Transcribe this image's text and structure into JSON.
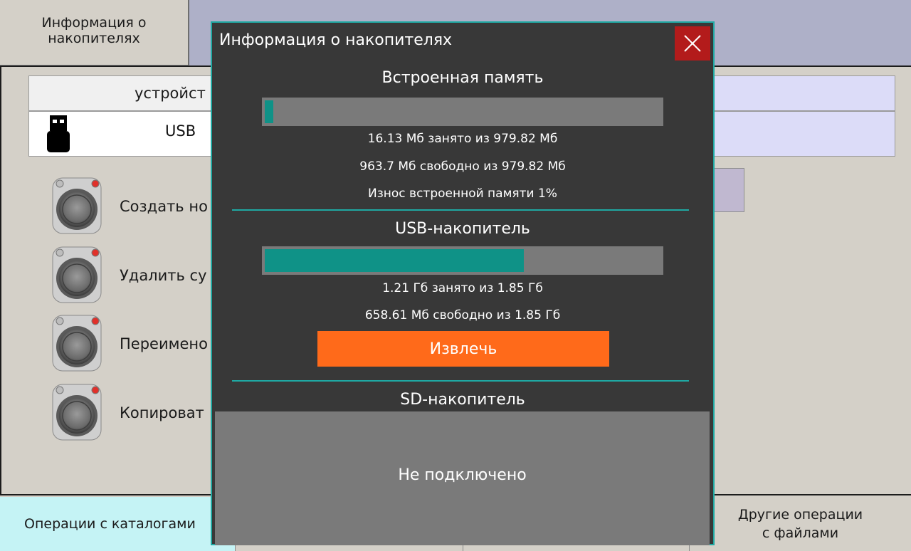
{
  "top_tabs": {
    "storage_info_line1": "Информация о",
    "storage_info_line2": "накопителях"
  },
  "device_table": {
    "header": "устройст",
    "device_name": "USB",
    "device_icon": "usb-drive-icon"
  },
  "operations": [
    {
      "label": "Создать но",
      "icon": "round-button-icon"
    },
    {
      "label": "Удалить су",
      "icon": "round-button-icon"
    },
    {
      "label": "Переимено",
      "icon": "round-button-icon"
    },
    {
      "label": "Копироват",
      "icon": "round-button-icon"
    }
  ],
  "bottom_tabs": {
    "directory_ops": "Операции с каталогами",
    "other_ops_line1": "Другие операции",
    "other_ops_line2": "с файлами"
  },
  "dialog": {
    "title": "Информация о накопителях",
    "close_icon": "close-icon",
    "internal": {
      "title": "Встроенная память",
      "used_fraction": 0.016,
      "used_text": "16.13 Мб занято из 979.82 Мб",
      "free_text": "963.7 Мб свободно из 979.82 Мб",
      "wear_text": "Износ встроенной памяти 1%"
    },
    "usb": {
      "title": "USB-накопитель",
      "used_fraction": 0.654,
      "used_text": "1.21 Гб занято из 1.85 Гб",
      "free_text": "658.61 Мб свободно из 1.85 Гб",
      "eject_label": "Извлечь"
    },
    "sd": {
      "title": "SD-накопитель",
      "status": "Не подключено"
    }
  },
  "colors": {
    "accent_teal": "#1fa9a3",
    "bar_fill": "#0f9287",
    "eject_orange": "#ff6a1a",
    "close_red": "#b31b1b"
  }
}
